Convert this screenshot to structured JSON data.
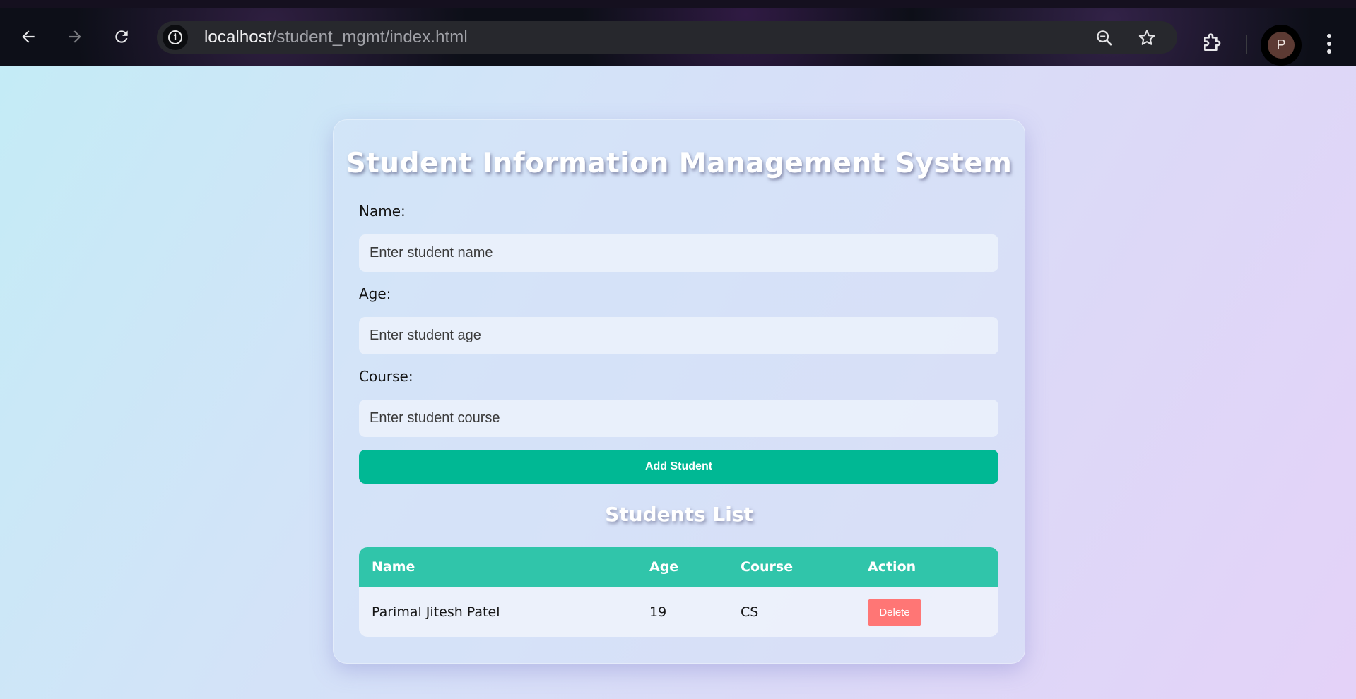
{
  "browser": {
    "url_host": "localhost",
    "url_path": "/student_mgmt/index.html",
    "profile_initial": "P",
    "icons": [
      "back-arrow-icon",
      "forward-arrow-icon",
      "reload-icon",
      "site-info-icon",
      "zoom-out-icon",
      "bookmark-star-icon",
      "extensions-puzzle-icon",
      "kebab-menu-icon"
    ]
  },
  "app": {
    "title": "Student Information Management System",
    "form": {
      "name_label": "Name:",
      "name_placeholder": "Enter student name",
      "age_label": "Age:",
      "age_placeholder": "Enter student age",
      "course_label": "Course:",
      "course_placeholder": "Enter student course",
      "submit_label": "Add Student"
    },
    "list_title": "Students List",
    "table": {
      "headers": [
        "Name",
        "Age",
        "Course",
        "Action"
      ],
      "rows": [
        {
          "name": "Parimal Jitesh Patel",
          "age": "19",
          "course": "CS",
          "action": "Delete"
        }
      ]
    }
  },
  "colors": {
    "accent": "#00b894",
    "table_header": "#30c5aa",
    "danger": "#ff7675"
  }
}
